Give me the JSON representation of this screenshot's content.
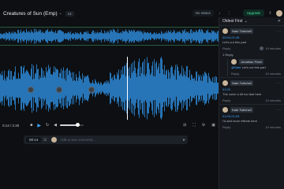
{
  "header": {
    "title": "Creatures of Sun (Emp)",
    "title_caret": "⌄",
    "version": "v4",
    "share_status": "No status",
    "upgrade": "Upgrade"
  },
  "transport": {
    "time": "0:14 / 2:30",
    "volume": 0.75
  },
  "comment_bar": {
    "time": "00:14",
    "placeholder": "Add a new comment..."
  },
  "sidebar": {
    "filter": "Oldest First",
    "comments": [
      {
        "author": "Nate Twitchell",
        "timestamp": "00:04-01:45",
        "text": "Let's cut this part",
        "reply_label": "Reply",
        "time_ago": "10 minutes"
      },
      {
        "reply_count": "1 Reply",
        "author": "Jonathan Finch",
        "mention": "@Nate",
        "text": "Let's cut this part",
        "reply_label": "Reply",
        "time_ago": "10 minutes"
      },
      {
        "author": "Nate Twitchell",
        "timestamp": "01:03",
        "text": "The voice a bit too fast here",
        "reply_label": "Reply",
        "time_ago": "10 minutes"
      },
      {
        "author": "Kate Twitchell",
        "timestamp": "01:03-01:53",
        "text": "I'd add more effects here",
        "reply_label": "Reply",
        "time_ago": "10 minutes"
      }
    ]
  },
  "colors": {
    "accent": "#3ea6ff",
    "wave": "#2f8fe0",
    "upgrade_text": "#4ee1a3"
  }
}
